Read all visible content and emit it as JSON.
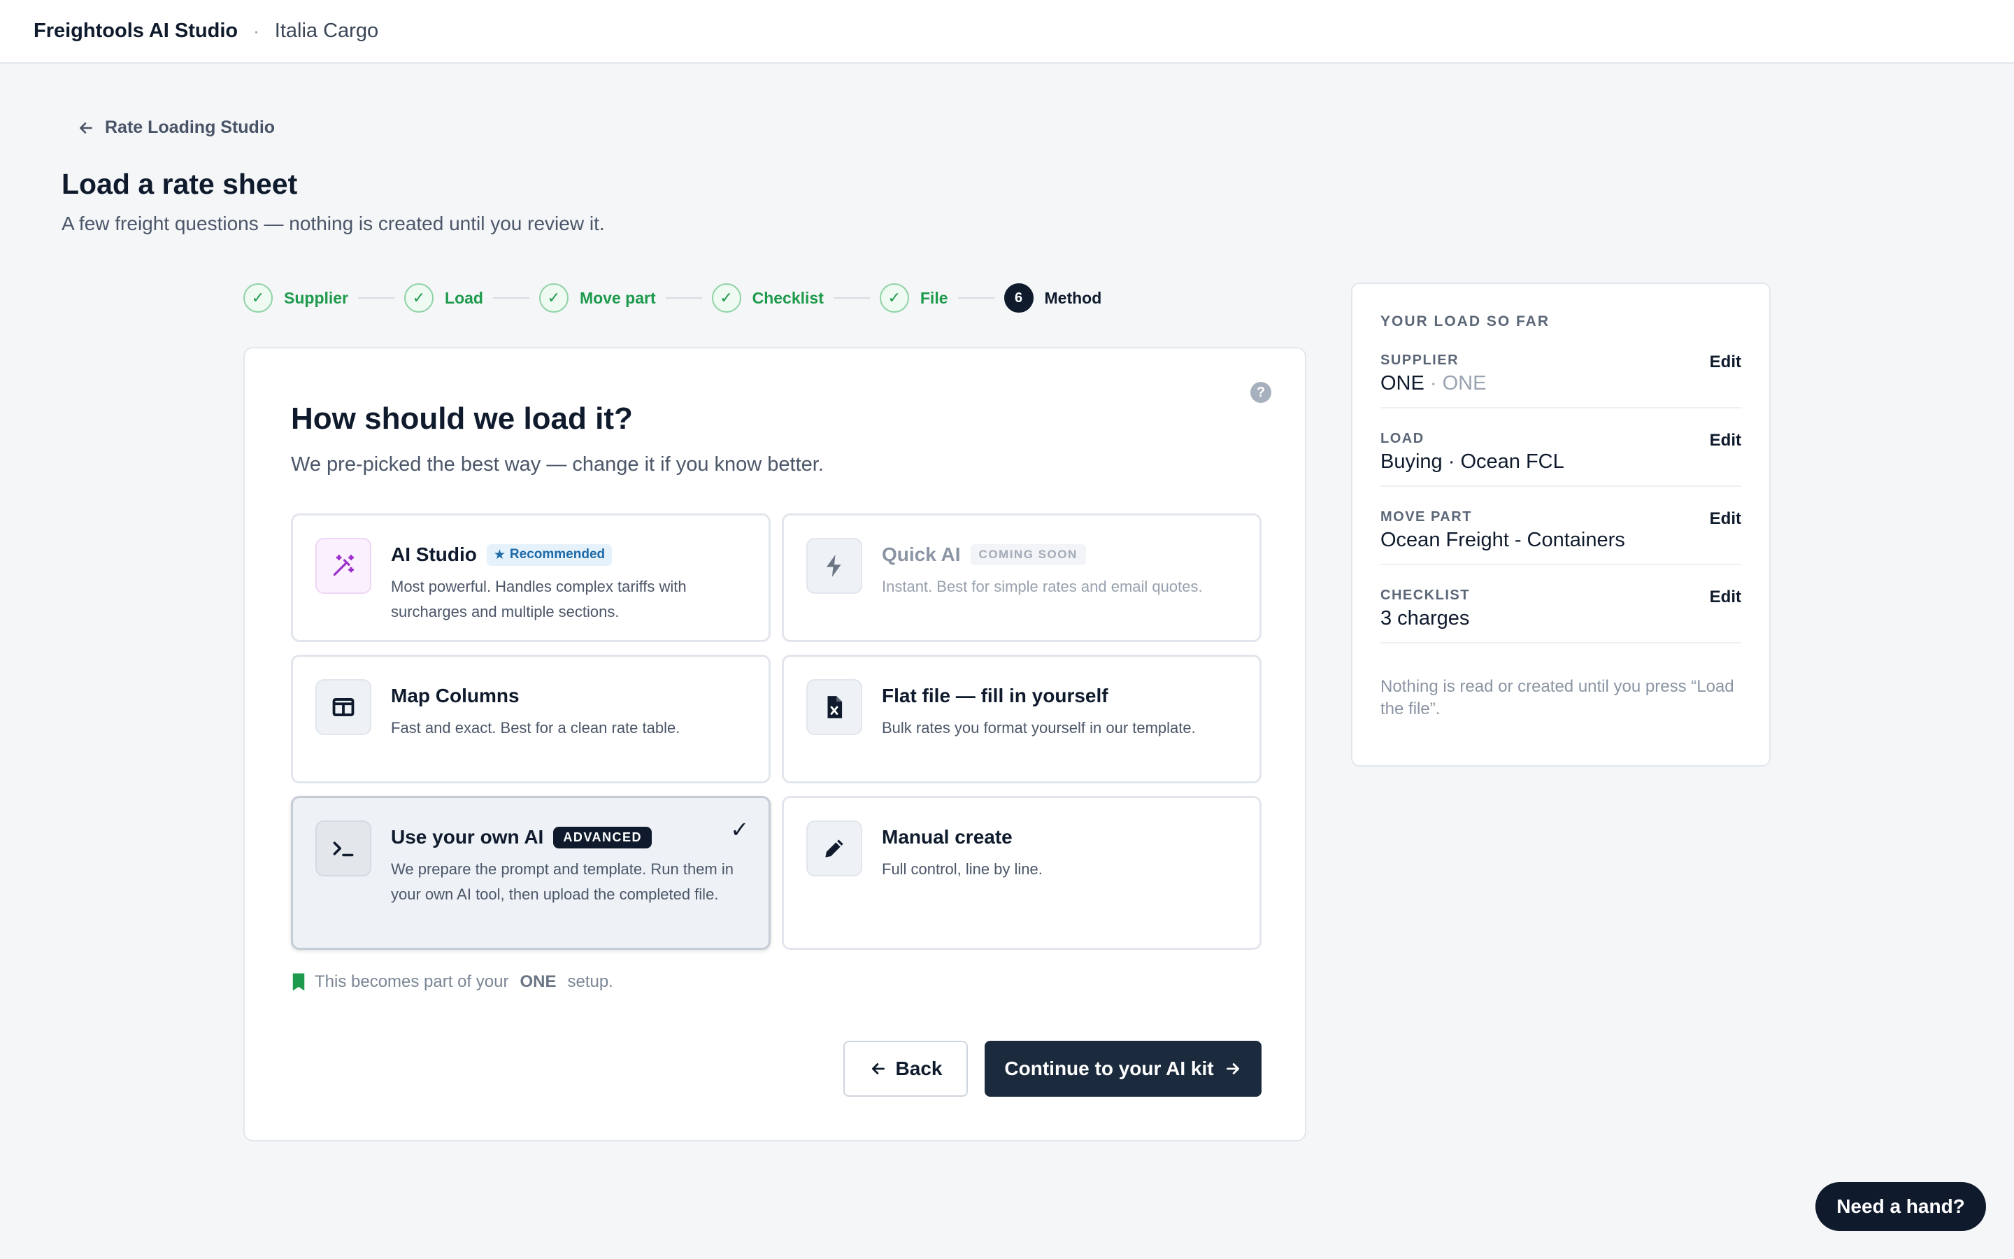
{
  "header": {
    "app_name": "Freightools AI Studio",
    "separator": "·",
    "org_name": "Italia Cargo"
  },
  "back_link": "Rate Loading Studio",
  "page": {
    "title": "Load a rate sheet",
    "subtitle": "A few freight questions — nothing is created until you review it."
  },
  "stepper": {
    "steps": [
      {
        "label": "Supplier",
        "state": "done"
      },
      {
        "label": "Load",
        "state": "done"
      },
      {
        "label": "Move part",
        "state": "done"
      },
      {
        "label": "Checklist",
        "state": "done"
      },
      {
        "label": "File",
        "state": "done"
      },
      {
        "label": "Method",
        "state": "active",
        "number": "6"
      }
    ]
  },
  "question": {
    "title": "How should we load it?",
    "subtitle": "We pre-picked the best way — change it if you know better.",
    "help": "?"
  },
  "options": [
    {
      "title": "AI Studio",
      "badge": "Recommended",
      "description": "Most powerful. Handles complex tariffs with surcharges and multiple sections.",
      "icon": "magic-wand-icon"
    },
    {
      "title": "Quick AI",
      "badge": "COMING SOON",
      "description": "Instant. Best for simple rates and email quotes.",
      "icon": "lightning-icon",
      "disabled": true
    },
    {
      "title": "Map Columns",
      "description": "Fast and exact. Best for a clean rate table.",
      "icon": "columns-icon"
    },
    {
      "title": "Flat file — fill in yourself",
      "description": "Bulk rates you format yourself in our template.",
      "icon": "excel-file-icon"
    },
    {
      "title": "Use your own AI",
      "badge": "ADVANCED",
      "description": "We prepare the prompt and template. Run them in your own AI tool, then upload the completed file.",
      "icon": "terminal-icon",
      "selected": true,
      "check": "✓"
    },
    {
      "title": "Manual create",
      "description": "Full control, line by line.",
      "icon": "pencil-icon"
    }
  ],
  "note": {
    "prefix": "This becomes part of your",
    "supplier": "ONE",
    "suffix": "setup."
  },
  "buttons": {
    "back": "Back",
    "continue": "Continue to your AI kit"
  },
  "summary": {
    "heading": "YOUR LOAD SO FAR",
    "rows": [
      {
        "label": "SUPPLIER",
        "value": "ONE",
        "value_muted": "· ONE",
        "edit": "Edit"
      },
      {
        "label": "LOAD",
        "value": "Buying · Ocean FCL",
        "edit": "Edit"
      },
      {
        "label": "MOVE PART",
        "value": "Ocean Freight - Containers",
        "edit": "Edit"
      },
      {
        "label": "CHECKLIST",
        "value": "3 charges",
        "edit": "Edit"
      }
    ],
    "footer": "Nothing is read or created until you press “Load the file”."
  },
  "help_button": "Need a hand?",
  "colors": {
    "success": "#1e9a4c",
    "primary": "#1b2a3c",
    "accent_purple": "#9b2fc9",
    "note_green": "#1e9a4c"
  }
}
